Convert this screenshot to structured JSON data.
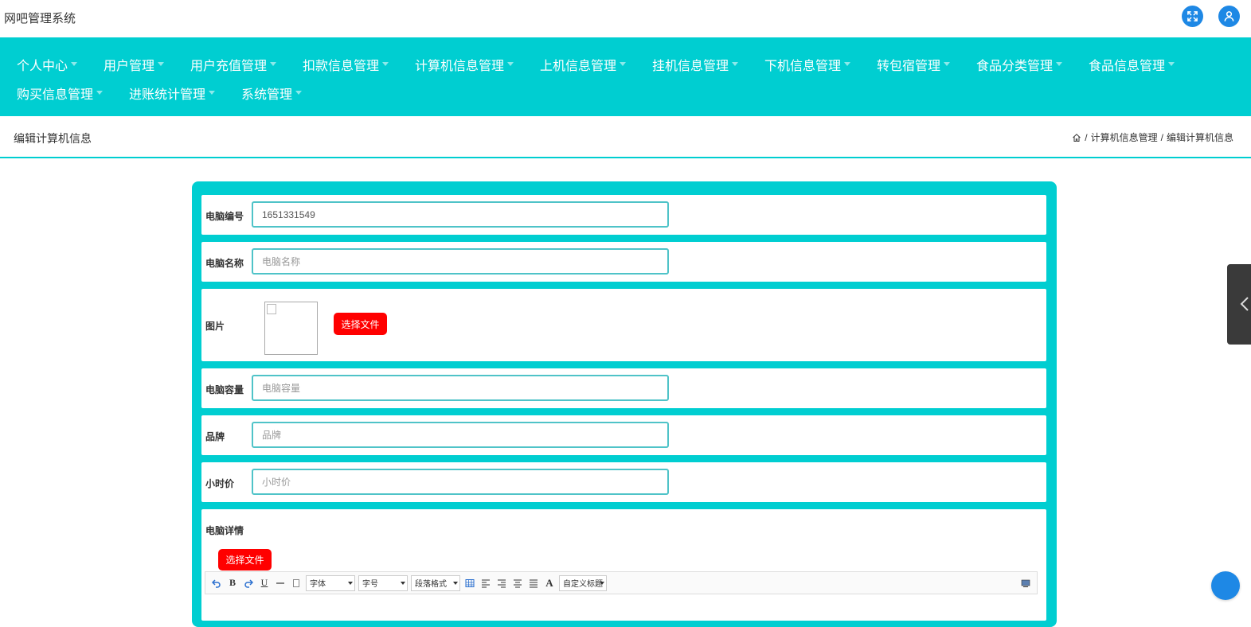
{
  "header": {
    "app_title": "网吧管理系统",
    "icons": [
      "fullscreen-icon",
      "user-icon"
    ],
    "accent_color": "#1e88e5"
  },
  "nav": {
    "bg_color": "#00ced1",
    "items": [
      {
        "label": "个人中心"
      },
      {
        "label": "用户管理"
      },
      {
        "label": "用户充值管理"
      },
      {
        "label": "扣款信息管理"
      },
      {
        "label": "计算机信息管理"
      },
      {
        "label": "上机信息管理"
      },
      {
        "label": "挂机信息管理"
      },
      {
        "label": "下机信息管理"
      },
      {
        "label": "转包宿管理"
      },
      {
        "label": "食品分类管理"
      },
      {
        "label": "食品信息管理"
      },
      {
        "label": "购买信息管理"
      },
      {
        "label": "进账统计管理"
      },
      {
        "label": "系统管理"
      }
    ]
  },
  "page": {
    "title": "编辑计算机信息",
    "breadcrumb": {
      "sep": "/",
      "parent": "计算机信息管理",
      "current": "编辑计算机信息"
    }
  },
  "form": {
    "computer_no": {
      "label": "电脑编号",
      "value": "1651331549"
    },
    "computer_name": {
      "label": "电脑名称",
      "placeholder": "电脑名称",
      "value": ""
    },
    "image": {
      "label": "图片",
      "button": "选择文件"
    },
    "capacity": {
      "label": "电脑容量",
      "placeholder": "电脑容量",
      "value": ""
    },
    "brand": {
      "label": "品牌",
      "placeholder": "品牌",
      "value": ""
    },
    "hourly_price": {
      "label": "小时价",
      "placeholder": "小时价",
      "value": ""
    },
    "details": {
      "label": "电脑详情",
      "button": "选择文件",
      "toolbar": {
        "bold": "B",
        "underline": "U",
        "font_family": "字体",
        "font_size": "字号",
        "paragraph": "段落格式",
        "font_color": "A",
        "custom_title": "自定义标题"
      }
    },
    "button_color": "#ff0000"
  }
}
